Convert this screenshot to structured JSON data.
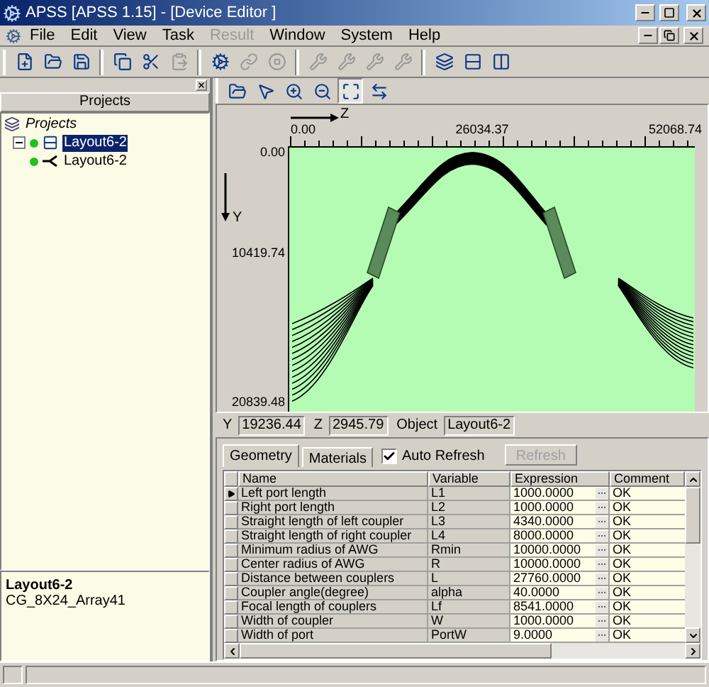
{
  "window": {
    "title": "APSS [APSS 1.15] - [Device Editor ]"
  },
  "menu": [
    {
      "label": "File",
      "disabled": false
    },
    {
      "label": "Edit",
      "disabled": false
    },
    {
      "label": "View",
      "disabled": false
    },
    {
      "label": "Task",
      "disabled": false
    },
    {
      "label": "Result",
      "disabled": true
    },
    {
      "label": "Window",
      "disabled": false
    },
    {
      "label": "System",
      "disabled": false
    },
    {
      "label": "Help",
      "disabled": false
    }
  ],
  "toolbar": [
    [
      {
        "kind": "new",
        "disabled": false
      },
      {
        "kind": "open",
        "disabled": false
      },
      {
        "kind": "save",
        "disabled": false
      }
    ],
    [
      {
        "kind": "copy",
        "disabled": false
      },
      {
        "kind": "cut",
        "disabled": false
      },
      {
        "kind": "paste",
        "disabled": true
      }
    ],
    [
      {
        "kind": "gear",
        "disabled": false
      },
      {
        "kind": "link",
        "disabled": true
      },
      {
        "kind": "stop",
        "disabled": true
      }
    ],
    [
      {
        "kind": "tool",
        "disabled": true
      },
      {
        "kind": "tool",
        "disabled": true
      },
      {
        "kind": "tool",
        "disabled": true
      },
      {
        "kind": "tool",
        "disabled": true
      }
    ],
    [
      {
        "kind": "cascade",
        "disabled": false
      },
      {
        "kind": "tile-h",
        "disabled": false
      },
      {
        "kind": "tile-v",
        "disabled": false
      }
    ]
  ],
  "sidebar": {
    "title": "Projects",
    "tree": [
      {
        "label": "Projects",
        "children": [
          {
            "label": "Layout6-2",
            "selected": true,
            "expanded": true,
            "children": [
              {
                "label": "Layout6-2",
                "selected": false
              }
            ]
          }
        ]
      }
    ],
    "info": {
      "title": "Layout6-2",
      "subtitle": "CG_8X24_Array41"
    }
  },
  "editor_toolbar": [
    {
      "kind": "open",
      "selected": false
    },
    {
      "kind": "select",
      "selected": false
    },
    {
      "kind": "zoom-in",
      "selected": false
    },
    {
      "kind": "zoom-out",
      "selected": false
    },
    {
      "kind": "fit",
      "selected": true
    },
    {
      "kind": "swap",
      "selected": false
    }
  ],
  "canvas": {
    "z_axis": "Z",
    "y_axis": "Y",
    "z_ticks": [
      "0.00",
      "26034.37",
      "52068.74"
    ],
    "y_ticks": [
      "0.00",
      "10419.74",
      "20839.48"
    ]
  },
  "coordinates": [
    {
      "label": "Y",
      "value": "19236.44"
    },
    {
      "label": "Z",
      "value": "2945.79"
    },
    {
      "label": "Object",
      "value": "Layout6-2"
    }
  ],
  "tabs": [
    {
      "label": "Geometry",
      "selected": true
    },
    {
      "label": "Materials",
      "selected": false
    }
  ],
  "auto_refresh": {
    "label": "Auto Refresh",
    "checked": true
  },
  "refresh_button": {
    "label": "Refresh",
    "disabled": true
  },
  "table": {
    "columns": [
      "Name",
      "Variable",
      "Expression",
      "Comment"
    ],
    "rows": [
      {
        "name": "Left port length",
        "variable": "L1",
        "expression": "1000.0000",
        "comment": "OK",
        "selected": true
      },
      {
        "name": "Right port length",
        "variable": "L2",
        "expression": "1000.0000",
        "comment": "OK",
        "selected": false
      },
      {
        "name": "Straight length of left coupler",
        "variable": "L3",
        "expression": "4340.0000",
        "comment": "OK",
        "selected": false
      },
      {
        "name": "Straight length of right coupler",
        "variable": "L4",
        "expression": "8000.0000",
        "comment": "OK",
        "selected": false
      },
      {
        "name": "Minimum radius of AWG",
        "variable": "Rmin",
        "expression": "10000.0000",
        "comment": "OK",
        "selected": false
      },
      {
        "name": "Center radius of AWG",
        "variable": "R",
        "expression": "10000.0000",
        "comment": "OK",
        "selected": false
      },
      {
        "name": "Distance between couplers",
        "variable": "L",
        "expression": "27760.0000",
        "comment": "OK",
        "selected": false
      },
      {
        "name": "Coupler angle(degree)",
        "variable": "alpha",
        "expression": "40.0000",
        "comment": "OK",
        "selected": false
      },
      {
        "name": "Focal length of couplers",
        "variable": "Lf",
        "expression": "8541.0000",
        "comment": "OK",
        "selected": false
      },
      {
        "name": "Width of coupler",
        "variable": "W",
        "expression": "1000.0000",
        "comment": "OK",
        "selected": false
      },
      {
        "name": "Width of port",
        "variable": "PortW",
        "expression": "9.0000",
        "comment": "OK",
        "selected": false
      }
    ]
  }
}
